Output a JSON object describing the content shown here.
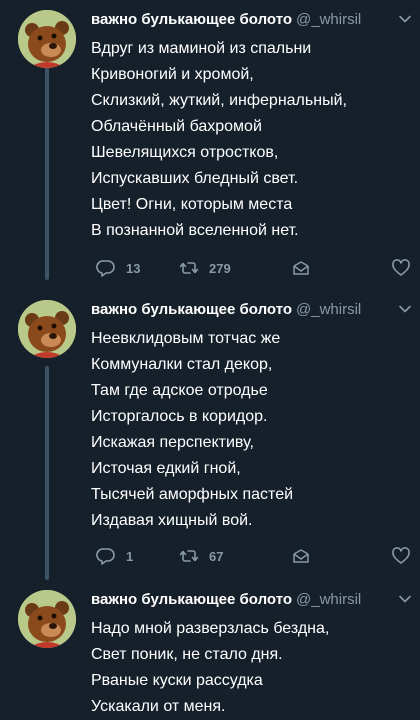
{
  "tweets": [
    {
      "name": "важно булькающее болото",
      "handle": "@_whirsil",
      "lines": [
        "Вдруг из маминой из спальни",
        "Кривоногий и хромой,",
        "Склизкий, жуткий, инфернальный,",
        "Облачённый бахромой",
        "Шевелящихся отростков,",
        "Испускавших бледный свет.",
        "Цвет! Огни, которым места",
        "В познанной вселенной нет."
      ],
      "reply_count": "13",
      "retweet_count": "279"
    },
    {
      "name": "важно булькающее болото",
      "handle": "@_whirsil",
      "lines": [
        "Неевклидовым тотчас же",
        "Коммуналки стал декор,",
        "Там где адское отродье",
        "Исторгалось в коридор.",
        "Искажая перспективу,",
        "Источая едкий гной,",
        "Тысячей аморфных пастей",
        "Издавая хищный вой."
      ],
      "reply_count": "1",
      "retweet_count": "67"
    },
    {
      "name": "важно булькающее болото",
      "handle": "@_whirsil",
      "lines": [
        "Надо мной разверзлась бездна,",
        "Свет поник, не стало дня.",
        "Рваные куски рассудка",
        "Ускакали от меня."
      ]
    }
  ],
  "colors": {
    "background": "#15202b",
    "secondary_text": "#8899a6",
    "thread_line": "#3d5466"
  },
  "icons": [
    "avatar-bear",
    "chevron-down-icon",
    "reply-icon",
    "retweet-icon",
    "direct-message-icon",
    "like-icon"
  ]
}
